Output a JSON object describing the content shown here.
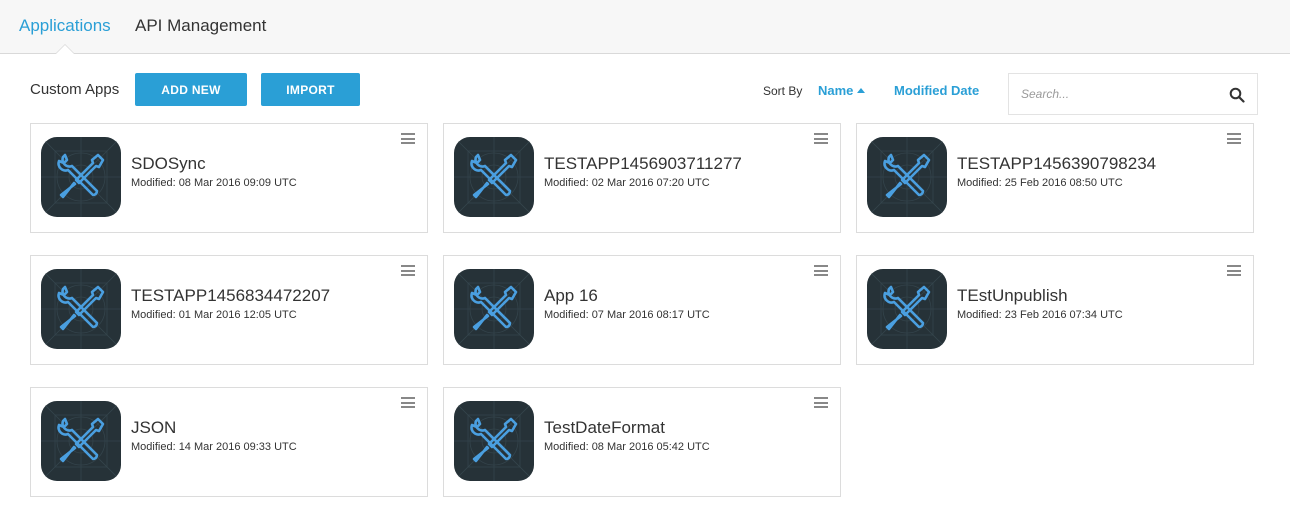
{
  "tabs": [
    {
      "label": "Applications",
      "active": true
    },
    {
      "label": "API Management",
      "active": false
    }
  ],
  "toolbar": {
    "section_label": "Custom Apps",
    "add_new_label": "ADD NEW",
    "import_label": "IMPORT",
    "sort_by_label": "Sort By",
    "sort_name_label": "Name",
    "sort_modified_label": "Modified Date",
    "search_placeholder": "Search..."
  },
  "colors": {
    "accent": "#2a9fd6",
    "icon_bg": "#263238",
    "icon_glyph": "#4a9fe0"
  },
  "icons": {
    "app": "wrench-screwdriver-icon",
    "menu": "hamburger-menu-icon",
    "search": "search-icon",
    "sort": "caret-up-icon"
  },
  "apps": [
    {
      "name": "SDOSync",
      "modified": "Modified: 08 Mar 2016 09:09 UTC"
    },
    {
      "name": "TESTAPP1456903711277",
      "modified": "Modified: 02 Mar 2016 07:20 UTC"
    },
    {
      "name": "TESTAPP1456390798234",
      "modified": "Modified: 25 Feb 2016 08:50 UTC"
    },
    {
      "name": "TESTAPP1456834472207",
      "modified": "Modified: 01 Mar 2016 12:05 UTC"
    },
    {
      "name": "App 16",
      "modified": "Modified: 07 Mar 2016 08:17 UTC"
    },
    {
      "name": "TEstUnpublish",
      "modified": "Modified: 23 Feb 2016 07:34 UTC"
    },
    {
      "name": "JSON",
      "modified": "Modified: 14 Mar 2016 09:33 UTC"
    },
    {
      "name": "TestDateFormat",
      "modified": "Modified: 08 Mar 2016 05:42 UTC"
    }
  ]
}
